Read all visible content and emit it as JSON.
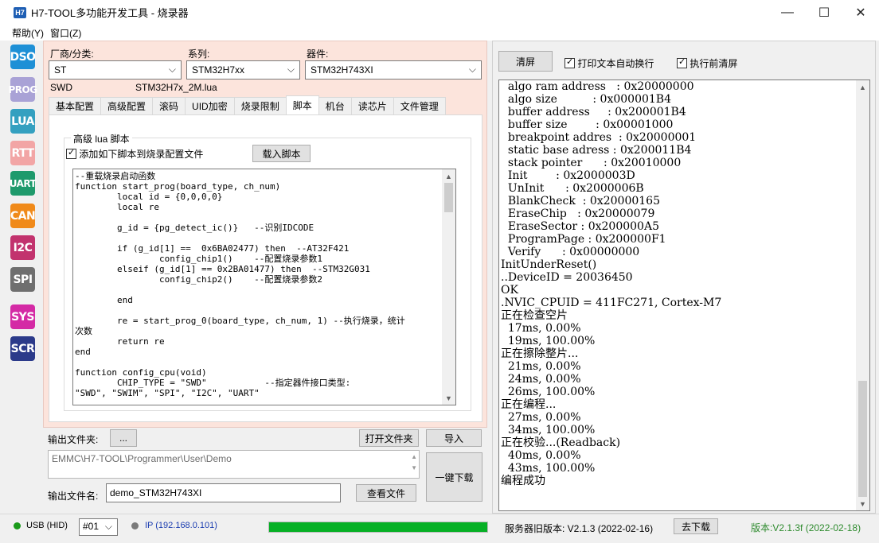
{
  "window": {
    "app_icon": "H7",
    "title": "H7-TOOL多功能开发工具 - 烧录器",
    "minimize": "—",
    "maximize": "☐",
    "close": "✕"
  },
  "menu": {
    "items": [
      "帮助(Y)",
      "窗口(Z)"
    ]
  },
  "toolbar": {
    "buttons": [
      {
        "label": "DSO",
        "color": "#1e90d6"
      },
      {
        "label": "PROG",
        "color": "#a9a2d6"
      },
      {
        "label": "LUA",
        "color": "#34a0c0"
      },
      {
        "label": "RTT",
        "color": "#f2a5a5"
      },
      {
        "label": "UART",
        "color": "#1e9a6c"
      },
      {
        "label": "CAN",
        "color": "#f08a1a"
      },
      {
        "label": "I2C",
        "color": "#c2336e"
      },
      {
        "label": "SPI",
        "color": "#6f6f6f"
      },
      {
        "label": "SYS",
        "color": "#d42aa5"
      },
      {
        "label": "SCR",
        "color": "#2b3a8a"
      }
    ]
  },
  "config": {
    "vendor_label": "厂商/分类:",
    "vendor_value": "ST",
    "series_label": "系列:",
    "series_value": "STM32H7xx",
    "device_label": "器件:",
    "device_value": "STM32H743XI",
    "interface": "SWD",
    "lua_file": "STM32H7x_2M.lua"
  },
  "tabs": [
    "基本配置",
    "高级配置",
    "滚码",
    "UID加密",
    "烧录限制",
    "脚本",
    "机台",
    "读芯片",
    "文件管理"
  ],
  "active_tab": "脚本",
  "script_tab": {
    "group_title": "高级 lua 脚本",
    "checkbox_label": "添加如下脚本到烧录配置文件",
    "load_button": "载入脚本",
    "code": "--重载烧录启动函数\nfunction start_prog(board_type, ch_num)\n        local id = {0,0,0,0}\n        local re\n\n        g_id = {pg_detect_ic()}   --识别IDCODE\n\n        if (g_id[1] ==  0x6BA02477) then  --AT32F421\n                config_chip1()    --配置烧录参数1\n        elseif (g_id[1] == 0x2BA01477) then  --STM32G031\n                config_chip2()    --配置烧录参数2\n\n        end\n\n        re = start_prog_0(board_type, ch_num, 1) --执行烧录，统计\n次数\n        return re\nend\n\nfunction config_cpu(void)\n        CHIP_TYPE = \"SWD\"           --指定器件接口类型:\n\"SWD\", \"SWIM\", \"SPI\", \"I2C\", \"UART\""
  },
  "output": {
    "folder_label": "输出文件夹:",
    "browse_button": "...",
    "open_folder_button": "打开文件夹",
    "import_button": "导入",
    "folder_path": "EMMC\\H7-TOOL\\Programmer\\User\\Demo",
    "file_label": "输出文件名:",
    "file_name": "demo_STM32H743XI",
    "view_file_button": "查看文件",
    "one_key_download_button": "一键下载"
  },
  "right": {
    "clear_button": "清屏",
    "auto_wrap_label": "打印文本自动换行",
    "clear_before_exec_label": "执行前清屏",
    "log": "  algo ram address   : 0x20000000\n  algo size          : 0x000001B4\n  buffer address     : 0x200001B4\n  buffer size        : 0x00001000\n  breakpoint addres  : 0x20000001\n  static base adress : 0x200011B4\n  stack pointer      : 0x20010000\n  Init        : 0x2000003D\n  UnInit      : 0x2000006B\n  BlankCheck  : 0x20000165\n  EraseChip   : 0x20000079\n  EraseSector : 0x200000A5\n  ProgramPage : 0x200000F1\n  Verify      : 0x00000000\nInitUnderReset()\n..DeviceID = 20036450\nOK\n.NVIC_CPUID = 411FC271, Cortex-M7\n正在检查空片\n  17ms, 0.00%\n  19ms, 100.00%\n正在擦除整片...\n  21ms, 0.00%\n  24ms, 0.00%\n  26ms, 100.00%\n正在编程...\n  27ms, 0.00%\n  34ms, 100.00%\n正在校验...(Readback)\n  40ms, 0.00%\n  43ms, 100.00%\n编程成功"
  },
  "status": {
    "usb_label": "USB (HID)",
    "usb_color": "#1a9a1a",
    "device_select": "#01",
    "ip_label": "IP (192.168.0.101)",
    "ip_color": "#7a7a7a",
    "progress": 1.0,
    "progress_color": "#06b025",
    "server_version": "服务器旧版本: V2.1.3 (2022-02-16)",
    "download_button": "去下载",
    "version": "版本:V2.1.3f (2022-02-18)",
    "version_color": "#2e8b2e"
  }
}
